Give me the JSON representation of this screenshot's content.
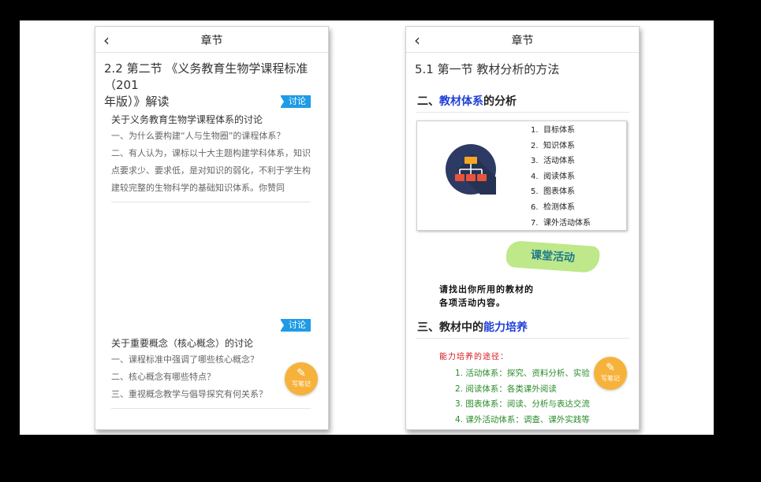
{
  "left": {
    "nav": {
      "back_icon": "chevron-left-icon",
      "title": "章节"
    },
    "section_title": "2.2 第二节 《义务教育生物学课程标准（201\n年版）》解读",
    "discussions": [
      {
        "tag": "讨论",
        "title": "关于义务教育生物学课程体系的讨论",
        "lines": [
          "一、为什么要构建“人与生物圈”的课程体系？"
        ],
        "body": "二、有人认为，课标以十大主题构建学科体系，知识点要求少、要求低，是对知识的弱化，不利于学生构建较完整的生物科学的基础知识体系。你赞同"
      },
      {
        "tag": "讨论",
        "title": "关于重要概念（核心概念）的讨论",
        "lines": [
          "一、课程标准中强调了哪些核心概念？",
          "二、核心概念有哪些特点？",
          "三、重视概念教学与倡导探究有何关系？"
        ]
      }
    ],
    "note_button": {
      "icon": "edit-note-icon",
      "label": "写笔记"
    }
  },
  "right": {
    "nav": {
      "back_icon": "chevron-left-icon",
      "title": "章节"
    },
    "section_title": "5.1 第一节 教材分析的方法",
    "heading1": {
      "prefix": "二、",
      "highlight": "教材体系",
      "suffix": "的分析"
    },
    "systems": [
      "目标体系",
      "知识体系",
      "活动体系",
      "阅读体系",
      "图表体系",
      "检测体系",
      "课外活动体系"
    ],
    "activity_label": "课堂活动",
    "handwritten": [
      "请找出你所用的教材的",
      "各项活动内容。"
    ],
    "heading2": {
      "prefix": "三、教材中的",
      "highlight": "能力培养",
      "suffix": ""
    },
    "path_title": "能力培养的途径：",
    "paths": [
      "1. 活动体系：探究、资料分析、实验",
      "2. 阅读体系：各类课外阅读",
      "3. 图表体系：阅读、分析与表达交流",
      "4. 课外活动体系：调查、课外实践等"
    ],
    "note_button": {
      "icon": "edit-note-icon",
      "label": "写笔记"
    }
  },
  "colors": {
    "tag_blue": "#1e9be6",
    "note_orange": "#f7b23b",
    "highlight_blue": "#1f3fd8",
    "path_red": "#d6131a",
    "path_green": "#2a8b2a",
    "badge_green": "#bfe88a"
  }
}
